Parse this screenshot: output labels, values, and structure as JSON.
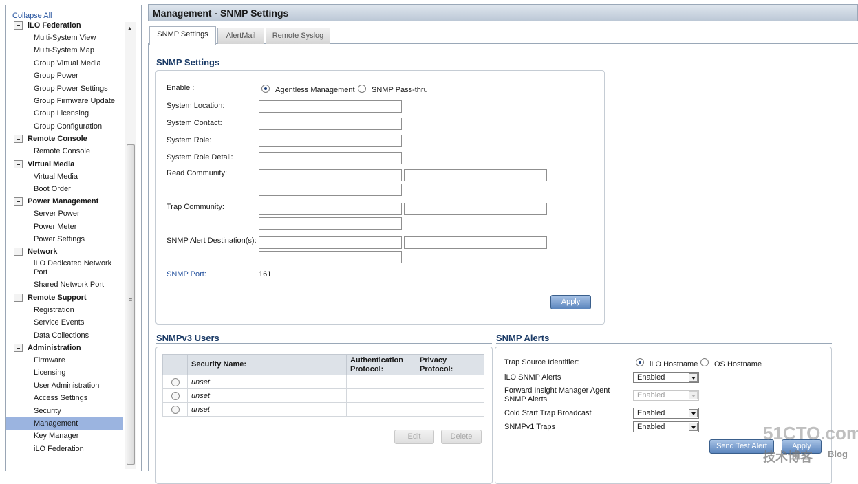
{
  "sidebar": {
    "collapse_all": "Collapse All",
    "groups": [
      {
        "title": "iLO Federation",
        "items": [
          "Multi-System View",
          "Multi-System Map",
          "Group Virtual Media",
          "Group Power",
          "Group Power Settings",
          "Group Firmware Update",
          "Group Licensing",
          "Group Configuration"
        ]
      },
      {
        "title": "Remote Console",
        "items": [
          "Remote Console"
        ]
      },
      {
        "title": "Virtual Media",
        "items": [
          "Virtual Media",
          "Boot Order"
        ]
      },
      {
        "title": "Power Management",
        "items": [
          "Server Power",
          "Power Meter",
          "Power Settings"
        ]
      },
      {
        "title": "Network",
        "items": [
          "iLO Dedicated Network Port",
          "Shared Network Port"
        ]
      },
      {
        "title": "Remote Support",
        "items": [
          "Registration",
          "Service Events",
          "Data Collections"
        ]
      },
      {
        "title": "Administration",
        "items": [
          "Firmware",
          "Licensing",
          "User Administration",
          "Access Settings",
          "Security",
          "Management",
          "Key Manager",
          "iLO Federation"
        ]
      }
    ],
    "active_item": "Management",
    "scroll_grip": "≡"
  },
  "header": {
    "title": "Management - SNMP Settings"
  },
  "tabs": [
    {
      "label": "SNMP Settings",
      "active": true
    },
    {
      "label": "AlertMail",
      "active": false
    },
    {
      "label": "Remote Syslog",
      "active": false
    }
  ],
  "snmp_settings": {
    "heading": "SNMP Settings",
    "enable_label": "Enable :",
    "enable_options": [
      {
        "label": "Agentless Management",
        "selected": true
      },
      {
        "label": "SNMP Pass-thru",
        "selected": false
      }
    ],
    "fields": {
      "system_location": {
        "label": "System Location:",
        "value": ""
      },
      "system_contact": {
        "label": "System Contact:",
        "value": ""
      },
      "system_role": {
        "label": "System Role:",
        "value": ""
      },
      "system_role_detail": {
        "label": "System Role Detail:",
        "value": ""
      }
    },
    "read_community": {
      "label": "Read Community:",
      "values": [
        "",
        "",
        ""
      ]
    },
    "trap_community": {
      "label": "Trap Community:",
      "values": [
        "",
        "",
        ""
      ]
    },
    "alert_destinations": {
      "label": "SNMP Alert Destination(s):",
      "values": [
        "",
        "",
        ""
      ]
    },
    "snmp_port": {
      "label": "SNMP Port:",
      "value": "161"
    },
    "apply_label": "Apply"
  },
  "snmpv3": {
    "heading": "SNMPv3 Users",
    "columns": [
      "Security Name:",
      "Authentication Protocol:",
      "Privacy Protocol:"
    ],
    "rows": [
      {
        "name": "unset",
        "auth": "",
        "privacy": ""
      },
      {
        "name": "unset",
        "auth": "",
        "privacy": ""
      },
      {
        "name": "unset",
        "auth": "",
        "privacy": ""
      }
    ],
    "edit_label": "Edit",
    "delete_label": "Delete"
  },
  "snmp_alerts": {
    "heading": "SNMP Alerts",
    "trap_source": {
      "label": "Trap Source Identifier:",
      "options": [
        {
          "label": "iLO Hostname",
          "selected": true
        },
        {
          "label": "OS Hostname",
          "selected": false
        }
      ]
    },
    "ilo_snmp_alerts": {
      "label": "iLO SNMP Alerts",
      "value": "Enabled"
    },
    "forward_insight": {
      "label": "Forward Insight Manager Agent SNMP Alerts",
      "value": "Enabled",
      "disabled": true
    },
    "cold_start": {
      "label": "Cold Start Trap Broadcast",
      "value": "Enabled"
    },
    "snmpv1_traps": {
      "label": "SNMPv1 Traps",
      "value": "Enabled"
    },
    "send_test_label": "Send Test Alert",
    "apply_label": "Apply"
  },
  "watermark": {
    "main": "51CTO.com",
    "sub": "技术博客",
    "blog": "Blog"
  },
  "colors": {
    "heading": "#1a3a66",
    "link": "#1f4e9c",
    "active_nav": "#9bb4e0",
    "button": "#5b85bd"
  }
}
